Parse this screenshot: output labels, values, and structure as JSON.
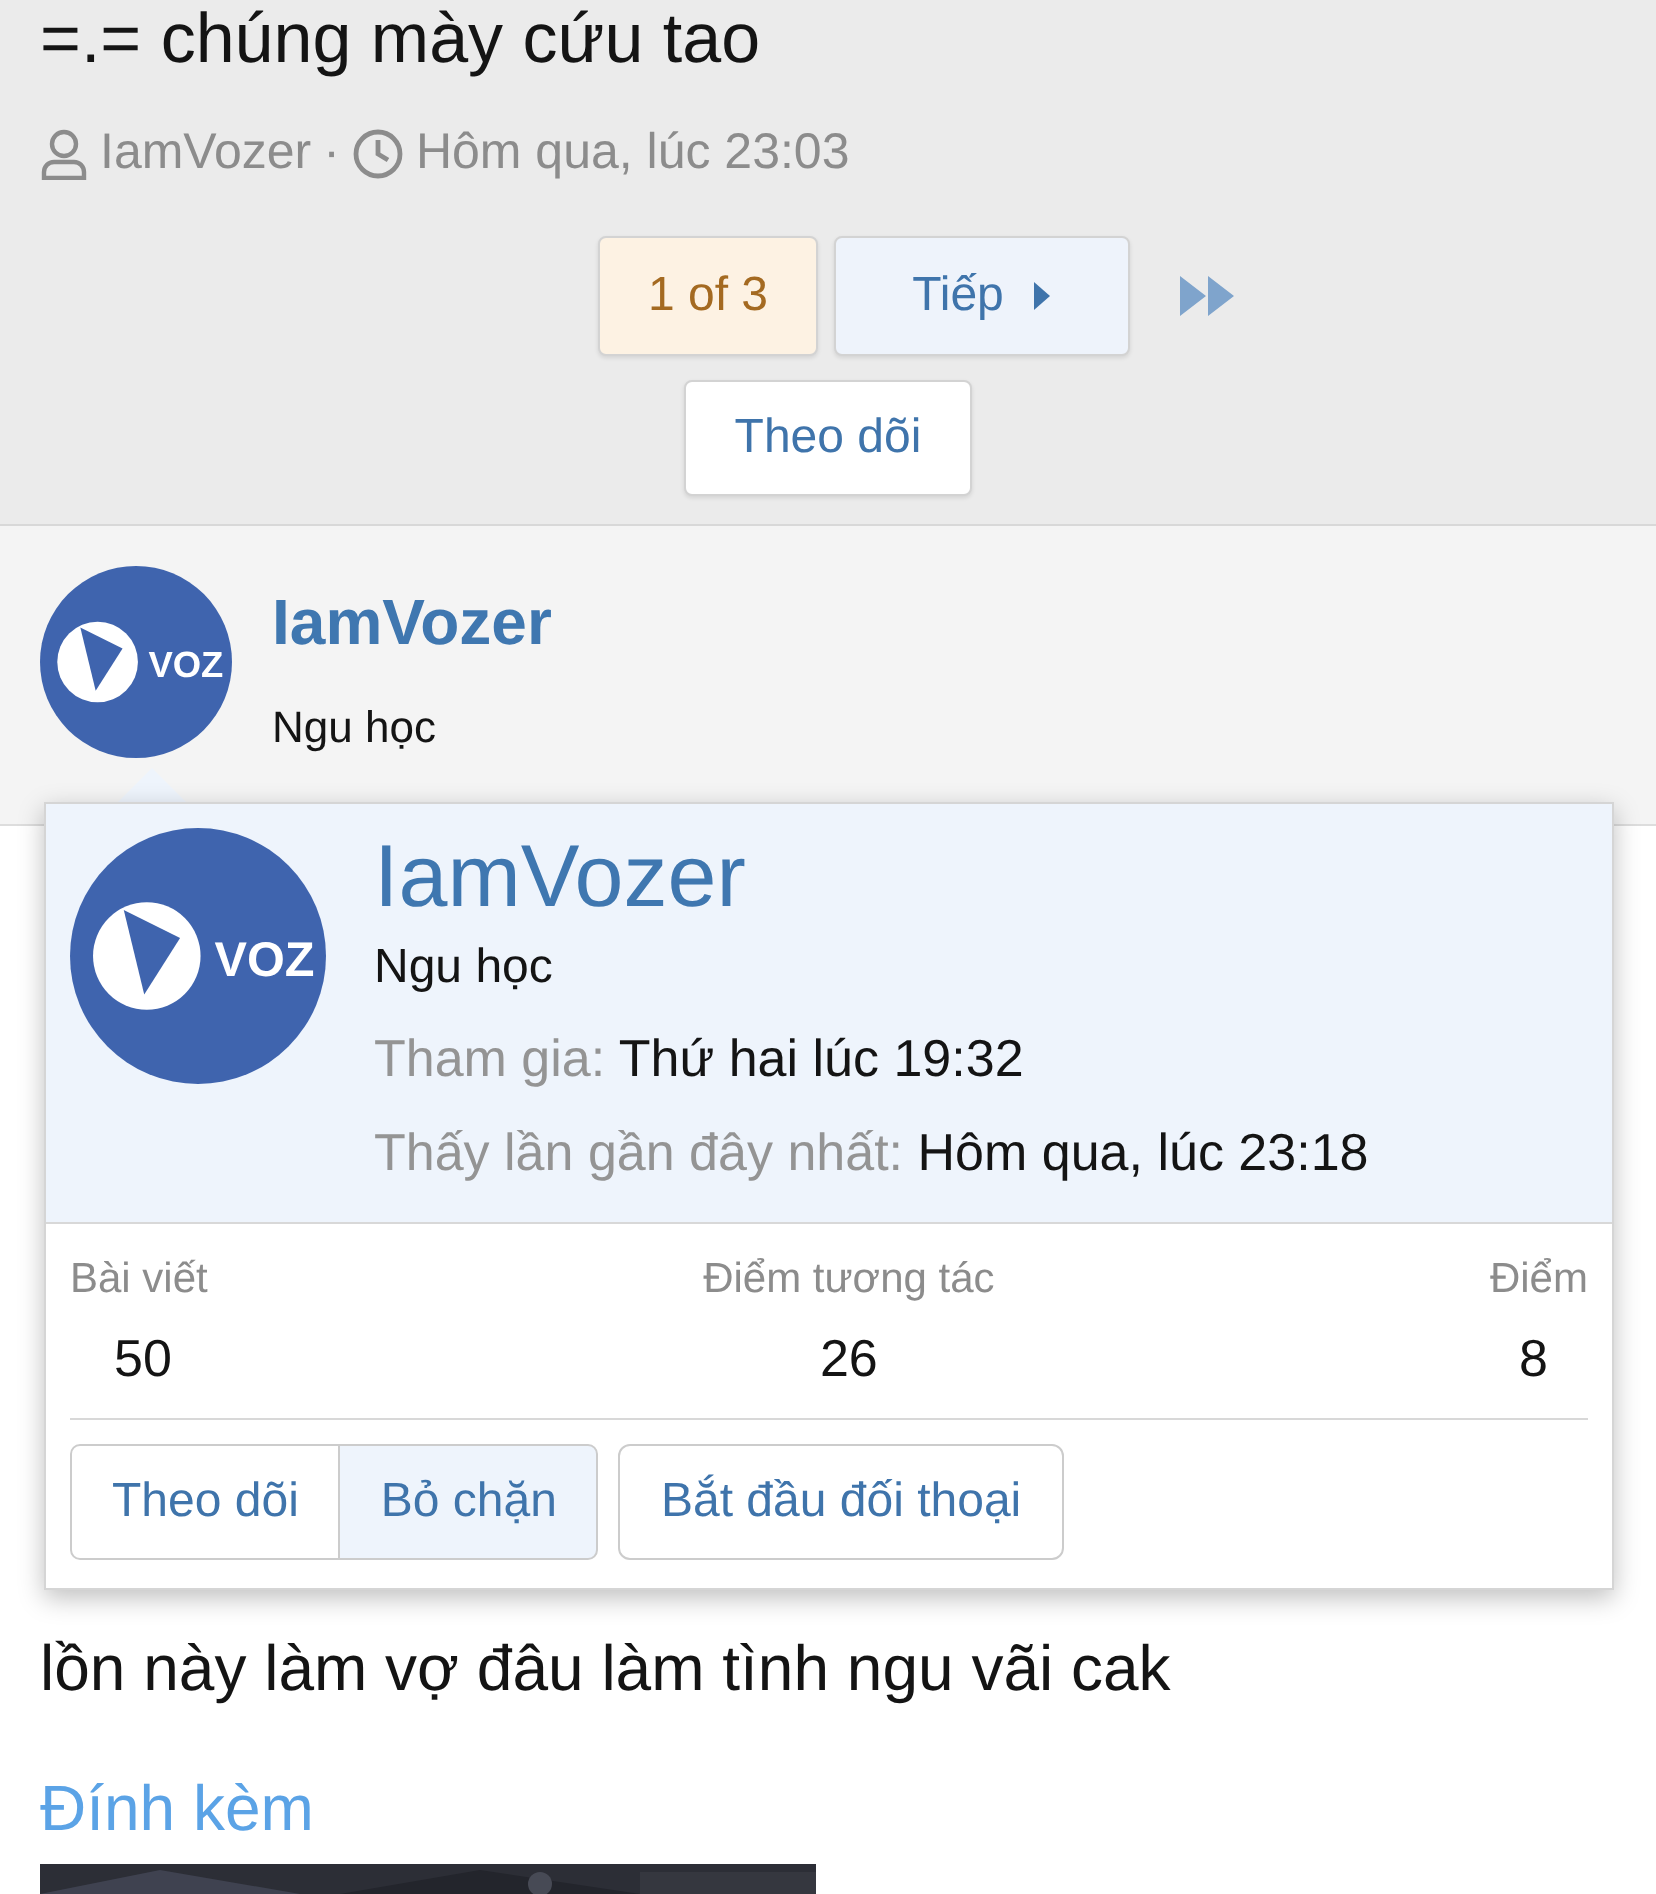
{
  "thread": {
    "title": "=.= chúng mày cứu tao",
    "author": "IamVozer",
    "separator": "·",
    "time": "Hôm qua, lúc 23:03"
  },
  "pagination": {
    "current": "1 of 3",
    "next": "Tiếp"
  },
  "watch_button": "Theo dõi",
  "post": {
    "avatar_text": "VOZ",
    "username": "IamVozer",
    "user_title": "Ngu học"
  },
  "member_card": {
    "avatar_text": "VOZ",
    "username": "IamVozer",
    "user_title": "Ngu học",
    "info": [
      {
        "label": "Tham gia:",
        "value": "Thứ hai lúc 19:32"
      },
      {
        "label": "Thấy lần gần đây nhất:",
        "value": "Hôm qua, lúc 23:18"
      }
    ],
    "stats": [
      {
        "label": "Bài viết",
        "value": "50"
      },
      {
        "label": "Điểm tương tác",
        "value": "26"
      },
      {
        "label": "Điểm",
        "value": "8"
      }
    ],
    "buttons": [
      {
        "label": "Theo dõi",
        "selected": false
      },
      {
        "label": "Bỏ chặn",
        "selected": true
      }
    ],
    "conversation_button": "Bắt đầu đối thoại"
  },
  "post_body": "lồn này làm vợ đâu làm tình ngu vãi cak",
  "attachments_title": "Đính kèm"
}
